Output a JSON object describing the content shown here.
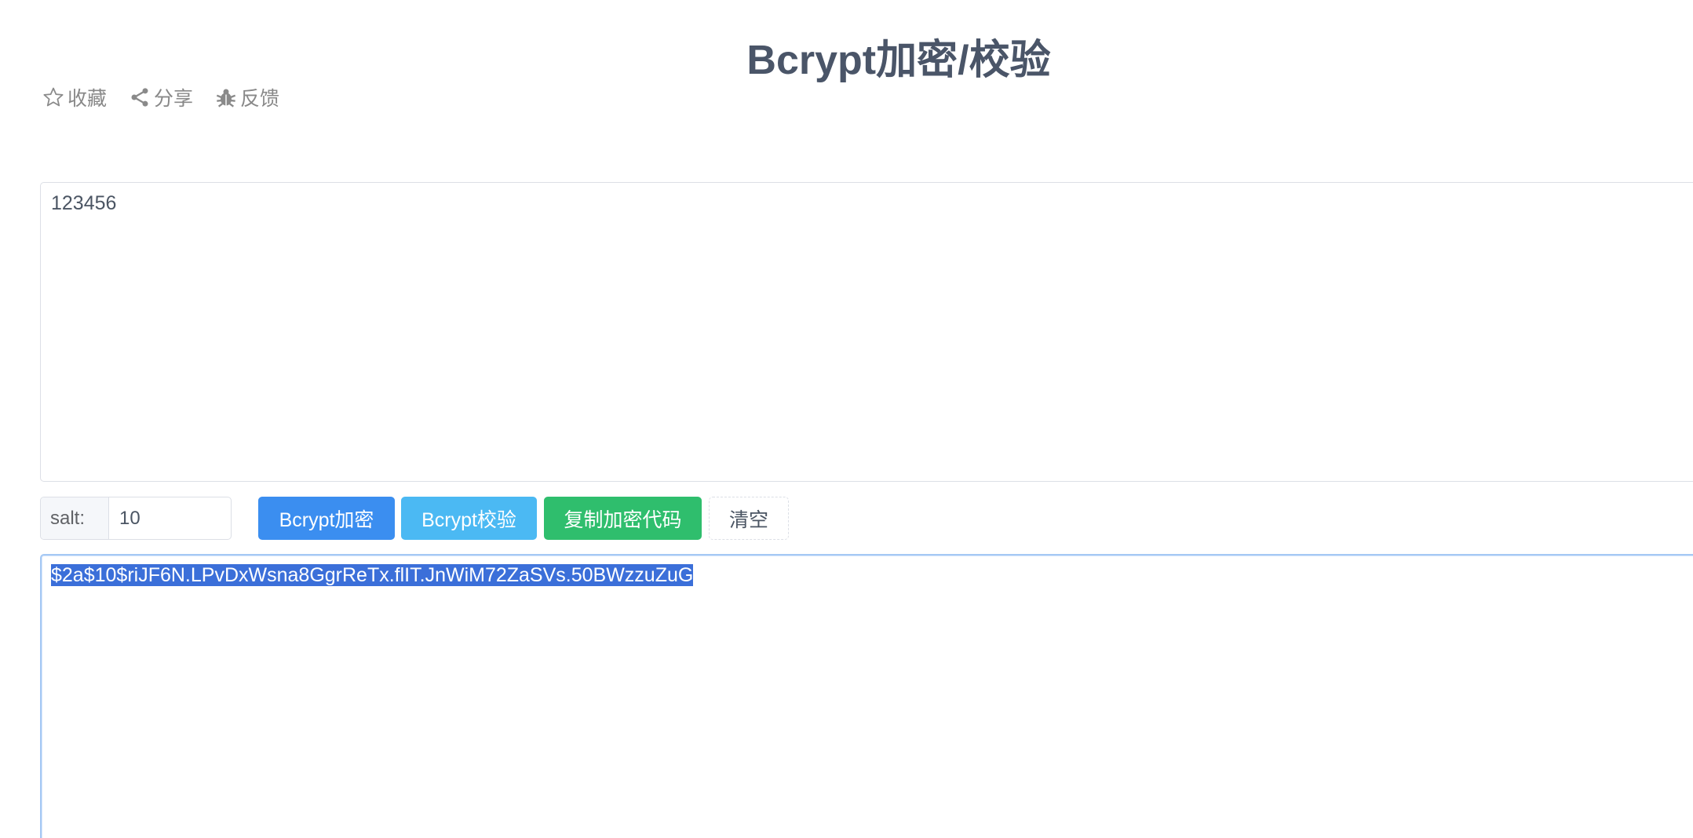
{
  "page": {
    "title": "Bcrypt加密/校验"
  },
  "toolbar": {
    "favorite_label": "收藏",
    "share_label": "分享",
    "feedback_label": "反馈",
    "favorite_icon": "star-outline-icon",
    "share_icon": "share-nodes-icon",
    "feedback_icon": "bug-icon"
  },
  "input": {
    "value": "123456"
  },
  "salt": {
    "label": "salt:",
    "value": "10"
  },
  "buttons": {
    "encrypt_label": "Bcrypt加密",
    "verify_label": "Bcrypt校验",
    "copy_code_label": "复制加密代码",
    "clear_label": "清空"
  },
  "output": {
    "value": "$2a$10$riJF6N.LPvDxWsna8GgrReTx.flIT.JnWiM72ZaSVs.50BWzzuZuG",
    "selected": true
  },
  "colors": {
    "encrypt_button": "#3b8ef0",
    "verify_button": "#4bb9f3",
    "copy_button": "#2fbe6d",
    "selection": "#3b6fd9",
    "title": "#4a5568"
  }
}
